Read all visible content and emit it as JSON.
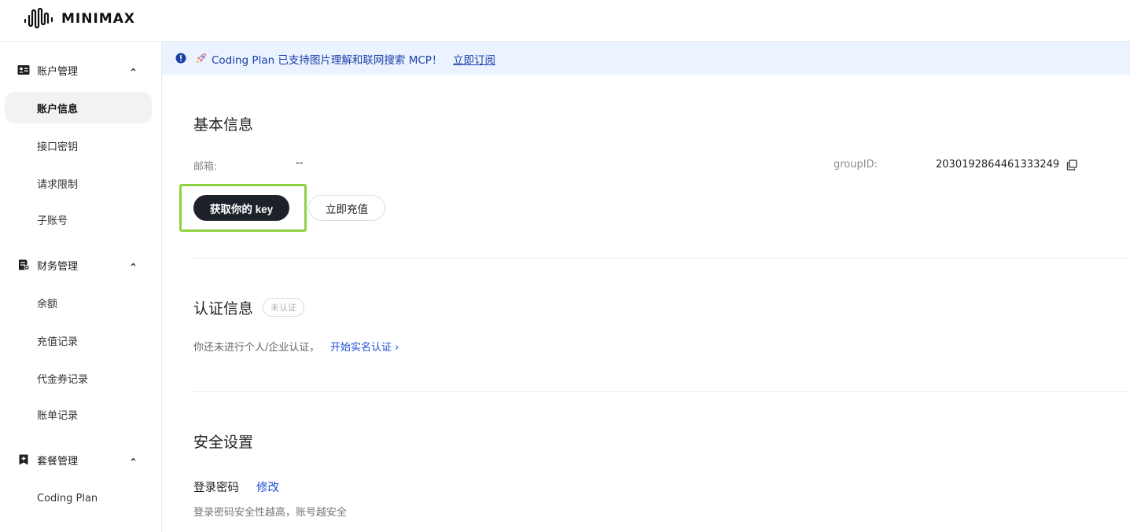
{
  "brand": {
    "name": "MINIMAX"
  },
  "sidebar": {
    "groups": [
      {
        "label": "账户管理",
        "icon": "id-card-icon",
        "items": [
          {
            "label": "账户信息",
            "active": true
          },
          {
            "label": "接口密钥"
          },
          {
            "label": "请求限制"
          },
          {
            "label": "子账号"
          }
        ]
      },
      {
        "label": "财务管理",
        "icon": "finance-doc-icon",
        "items": [
          {
            "label": "余额"
          },
          {
            "label": "充值记录"
          },
          {
            "label": "代金券记录"
          },
          {
            "label": "账单记录"
          }
        ]
      },
      {
        "label": "套餐管理",
        "icon": "plan-bookmark-icon",
        "items": [
          {
            "label": "Coding Plan"
          }
        ]
      }
    ]
  },
  "notice": {
    "text": "Coding Plan 已支持图片理解和联网搜索 MCP！",
    "link": "立即订阅"
  },
  "basic_info": {
    "title": "基本信息",
    "email_label": "邮箱:",
    "email_value": "--",
    "group_label": "groupID:",
    "group_value": "2030192864461333249",
    "get_key_button": "获取你的 key",
    "recharge_button": "立即充值"
  },
  "verification": {
    "title": "认证信息",
    "badge": "未认证",
    "text": "你还未进行个人/企业认证，",
    "link": "开始实名认证 ›"
  },
  "security": {
    "title": "安全设置",
    "password_label": "登录密码",
    "password_action": "修改",
    "password_hint": "登录密码安全性越高，账号越安全"
  },
  "colors": {
    "accent_link": "#1d4ed8",
    "notice_bg": "#eaf3ff",
    "dark_button": "#1d2129",
    "highlight": "#8ed23f"
  }
}
